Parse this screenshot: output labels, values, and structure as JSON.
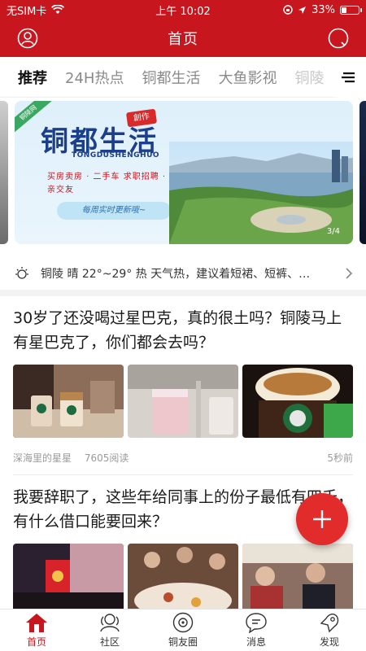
{
  "status_bar": {
    "carrier": "无SIM卡",
    "time": "上午 10:02",
    "battery": "33%",
    "battery_level": 0.33
  },
  "header": {
    "title": "首页"
  },
  "tabs": [
    {
      "label": "推荐",
      "active": true
    },
    {
      "label": "24H热点",
      "active": false
    },
    {
      "label": "铜都生活",
      "active": false
    },
    {
      "label": "大鱼影视",
      "active": false
    },
    {
      "label": "铜陵",
      "active": false
    }
  ],
  "banner": {
    "corner_tag": "铜陵网",
    "title": "铜都生活",
    "seal": "創作",
    "pinyin": "TONGDUSHENGHUO",
    "tags": "买房卖房 · 二手车 求职招聘 · 相亲交友",
    "ribbon": "每周实时更新哦~",
    "counter": "3/4"
  },
  "weather": {
    "text": "铜陵 晴 22°~29° 热 天气热，建议着短裙、短裤、…"
  },
  "articles": [
    {
      "title": "30岁了还没喝过星巴克，真的很土吗？铜陵马上有星巴克了，你们都会去吗？",
      "author": "深海里的星星",
      "reads": "7605阅读",
      "time": "5秒前"
    },
    {
      "title": "我要辞职了，这些年给同事上的份子最低有四千，有什么借口能要回来？"
    }
  ],
  "bottom_nav": [
    {
      "label": "首页",
      "icon": "home-icon",
      "active": true
    },
    {
      "label": "社区",
      "icon": "community-icon",
      "active": false
    },
    {
      "label": "铜友圈",
      "icon": "circle-icon",
      "active": false
    },
    {
      "label": "消息",
      "icon": "message-icon",
      "active": false
    },
    {
      "label": "发现",
      "icon": "discover-icon",
      "active": false
    }
  ],
  "colors": {
    "brand": "#c8161e",
    "fab": "#e22b2b"
  }
}
